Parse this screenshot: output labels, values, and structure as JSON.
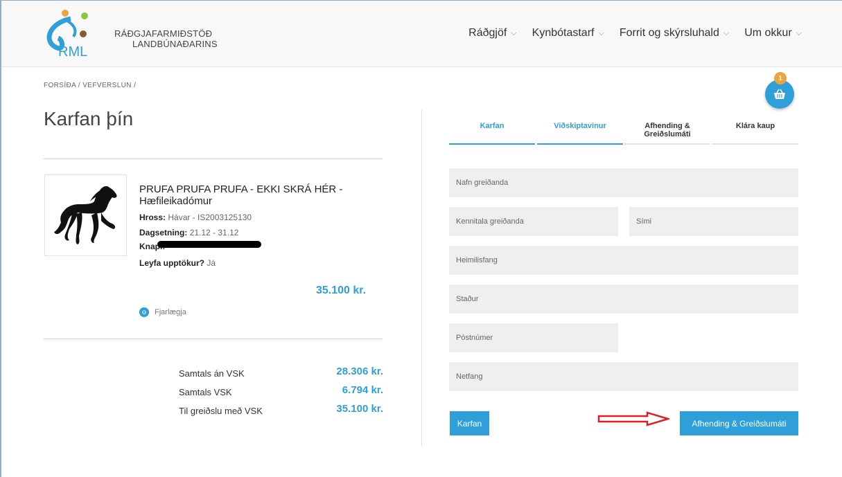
{
  "brand": {
    "logo_text": "RML",
    "line1": "RÁÐGJAFARMIÐSTÖÐ",
    "line2": "LANDBÚNAÐARINS",
    "accent_color": "#2e9fd8"
  },
  "nav": {
    "items": [
      {
        "label": "Ráðgjöf"
      },
      {
        "label": "Kynbótastarf"
      },
      {
        "label": "Forrit og skýrsluhald"
      },
      {
        "label": "Um okkur"
      }
    ]
  },
  "breadcrumb": "FORSÍÐA / VEFVERSLUN /",
  "cart": {
    "count": "1",
    "icon": "basket-icon"
  },
  "page_title": "Karfan þín",
  "product": {
    "image_icon": "horse-icon",
    "title": "PRUFA PRUFA PRUFA - EKKI SKRÁ HÉR - Hæfileikadómur",
    "horse_label": "Hross:",
    "horse_value": "Hávar - IS2003125130",
    "date_label": "Dagsetning:",
    "date_value": "21.12 - 31.12",
    "rider_label": "Knapi:",
    "recording_label": "Leyfa upptökur?",
    "recording_value": "Já",
    "price": "35.100 kr.",
    "remove_label": "Fjarlægja"
  },
  "totals": [
    {
      "label": "Samtals án VSK",
      "value": "28.306 kr."
    },
    {
      "label": "Samtals VSK",
      "value": "6.794 kr."
    },
    {
      "label": "Til greiðslu með VSK",
      "value": "35.100 kr."
    }
  ],
  "tabs": [
    {
      "label": "Karfan",
      "active": true
    },
    {
      "label": "Viðskiptavinur",
      "active": true
    },
    {
      "label": "Afhending & Greiðslumáti",
      "active": false
    },
    {
      "label": "Klára kaup",
      "active": false
    }
  ],
  "form": {
    "payer_name": {
      "placeholder": "Nafn greiðanda",
      "value": ""
    },
    "payer_ssn": {
      "placeholder": "Kennitala greiðanda",
      "value": ""
    },
    "phone": {
      "placeholder": "Sími",
      "value": ""
    },
    "address": {
      "placeholder": "Heimilisfang",
      "value": ""
    },
    "place": {
      "placeholder": "Staður",
      "value": ""
    },
    "postcode": {
      "placeholder": "Póstnúmer",
      "value": ""
    },
    "email": {
      "placeholder": "Netfang",
      "value": ""
    }
  },
  "buttons": {
    "back": "Karfan",
    "next": "Afhending & Greiðslumáti"
  },
  "annotation_color": "#e02020"
}
